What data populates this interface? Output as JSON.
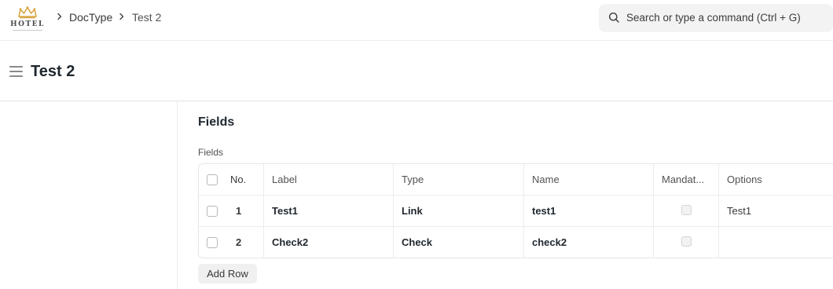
{
  "navbar": {
    "logo_text": "HOTEL",
    "breadcrumbs": [
      "DocType",
      "Test 2"
    ],
    "search_placeholder": "Search or type a command (Ctrl + G)"
  },
  "page": {
    "title": "Test 2"
  },
  "section": {
    "title": "Fields",
    "field_label": "Fields"
  },
  "table": {
    "columns": [
      "No.",
      "Label",
      "Type",
      "Name",
      "Mandat...",
      "Options"
    ],
    "rows": [
      {
        "no": "1",
        "label": "Test1",
        "type": "Link",
        "name": "test1",
        "mandatory": false,
        "options": "Test1"
      },
      {
        "no": "2",
        "label": "Check2",
        "type": "Check",
        "name": "check2",
        "mandatory": false,
        "options": ""
      }
    ],
    "add_row_label": "Add Row"
  },
  "colors": {
    "logo_gold": "#d9a441",
    "text_primary": "#1f272e",
    "search_bg": "#f3f3f3"
  }
}
